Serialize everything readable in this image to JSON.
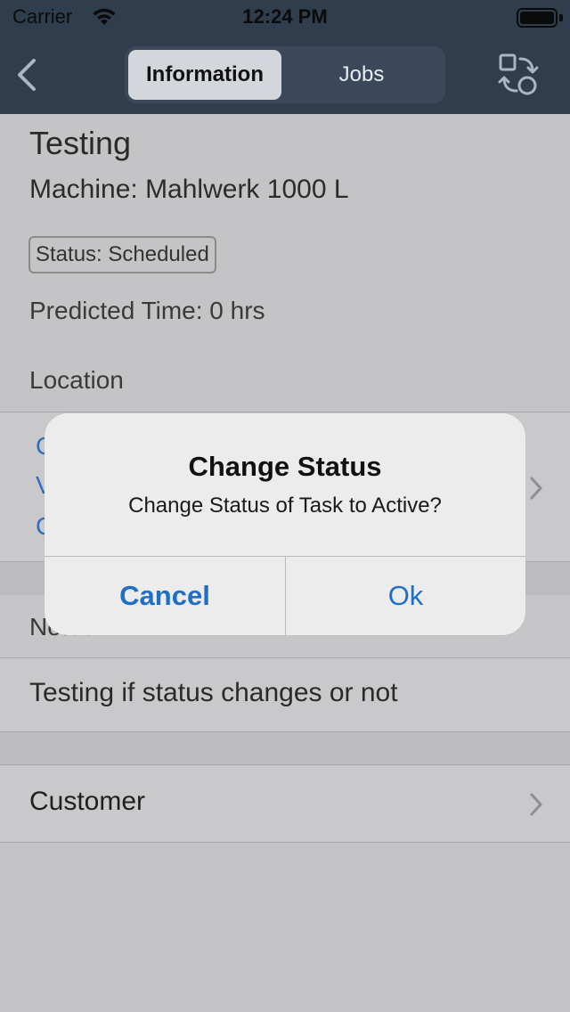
{
  "status_bar": {
    "carrier": "Carrier",
    "time": "12:24 PM"
  },
  "nav": {
    "tabs": [
      {
        "label": "Information",
        "active": true
      },
      {
        "label": "Jobs",
        "active": false
      }
    ],
    "back_icon": "chevron-left-icon",
    "swap_icon": "swap-shapes-icon"
  },
  "task": {
    "title": "Testing",
    "machine": "Machine: Mahlwerk 1000 L",
    "status": "Status: Scheduled",
    "predicted_time": "Predicted Time: 0 hrs",
    "location_label": "Location",
    "location_lines": [
      "C",
      "V",
      "C"
    ],
    "notes_label": "Notes",
    "notes_text": "Testing if status changes or not",
    "customer_label": "Customer"
  },
  "alert": {
    "title": "Change Status",
    "message": "Change Status of Task to Active?",
    "cancel_label": "Cancel",
    "ok_label": "Ok"
  },
  "colors": {
    "nav_background": "#2f3d4d",
    "accent_blue": "#1f6fc5",
    "dim_background": "#c4c4c6"
  }
}
